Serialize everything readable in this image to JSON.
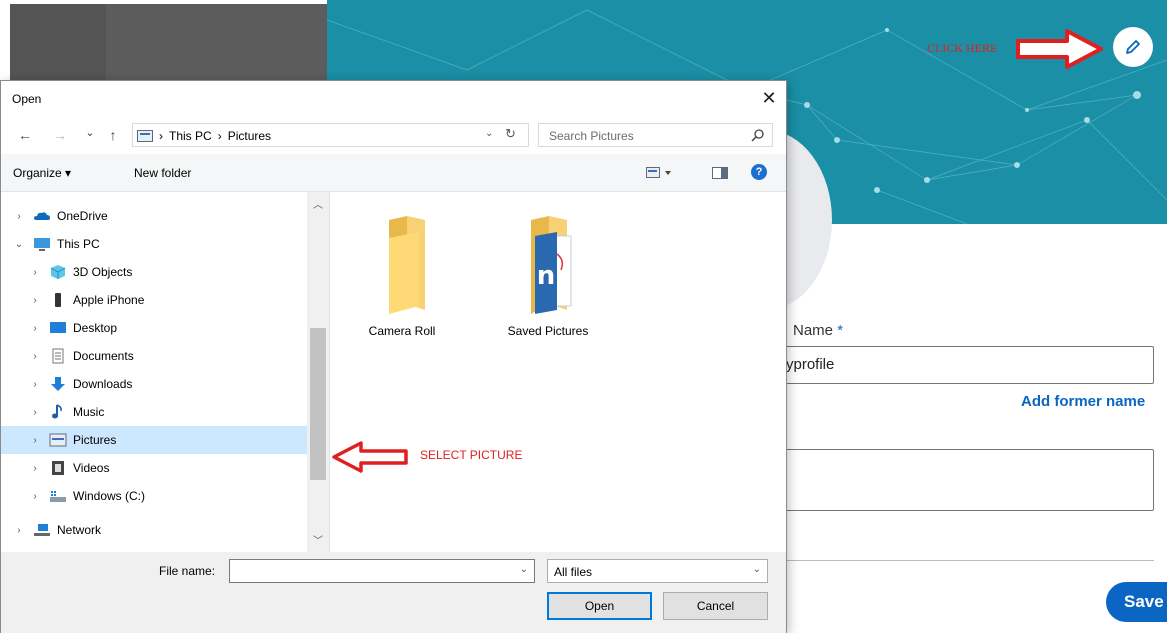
{
  "annotations": {
    "click_here": "CLICK HERE",
    "select_picture": "SELECT PICTURE"
  },
  "profile": {
    "name_label": "Name",
    "required_mark": "*",
    "name_value": "yprofile",
    "add_former_name": "Add former name",
    "save_label": "Save"
  },
  "dialog": {
    "title": "Open",
    "close_symbol": "✕",
    "nav": {
      "back": "←",
      "forward": "→",
      "recent": "⌄",
      "up": "↑",
      "breadcrumbs": [
        "This PC",
        "Pictures"
      ],
      "separator": "›",
      "search_placeholder": "Search Pictures"
    },
    "toolbar": {
      "organize": "Organize ▾",
      "new_folder": "New folder",
      "help": "?"
    },
    "tree": [
      {
        "label": "OneDrive",
        "icon": "onedrive-icon",
        "expanded": false,
        "indent": 0
      },
      {
        "label": "This PC",
        "icon": "computer-icon",
        "expanded": true,
        "indent": 0
      },
      {
        "label": "3D Objects",
        "icon": "3d-objects-icon",
        "expanded": false,
        "indent": 1
      },
      {
        "label": "Apple iPhone",
        "icon": "phone-icon",
        "expanded": false,
        "indent": 1
      },
      {
        "label": "Desktop",
        "icon": "desktop-icon",
        "expanded": false,
        "indent": 1
      },
      {
        "label": "Documents",
        "icon": "documents-icon",
        "expanded": false,
        "indent": 1
      },
      {
        "label": "Downloads",
        "icon": "downloads-icon",
        "expanded": false,
        "indent": 1
      },
      {
        "label": "Music",
        "icon": "music-icon",
        "expanded": false,
        "indent": 1
      },
      {
        "label": "Pictures",
        "icon": "pictures-icon",
        "expanded": false,
        "indent": 1,
        "selected": true
      },
      {
        "label": "Videos",
        "icon": "videos-icon",
        "expanded": false,
        "indent": 1
      },
      {
        "label": "Windows (C:)",
        "icon": "drive-icon",
        "expanded": false,
        "indent": 1
      },
      {
        "label": "Network",
        "icon": "network-icon",
        "expanded": false,
        "indent": 0
      }
    ],
    "files": [
      {
        "label": "Camera Roll",
        "icon": "folder-icon"
      },
      {
        "label": "Saved Pictures",
        "icon": "folder-with-document-icon"
      }
    ],
    "bottom": {
      "file_name_label": "File name:",
      "file_name_value": "",
      "filter_value": "All files",
      "open_label": "Open",
      "cancel_label": "Cancel"
    }
  },
  "colors": {
    "banner": "#1a8fa5",
    "accent": "#0a66c2",
    "annotation_red": "#e02020",
    "selection": "#cce8ff"
  }
}
